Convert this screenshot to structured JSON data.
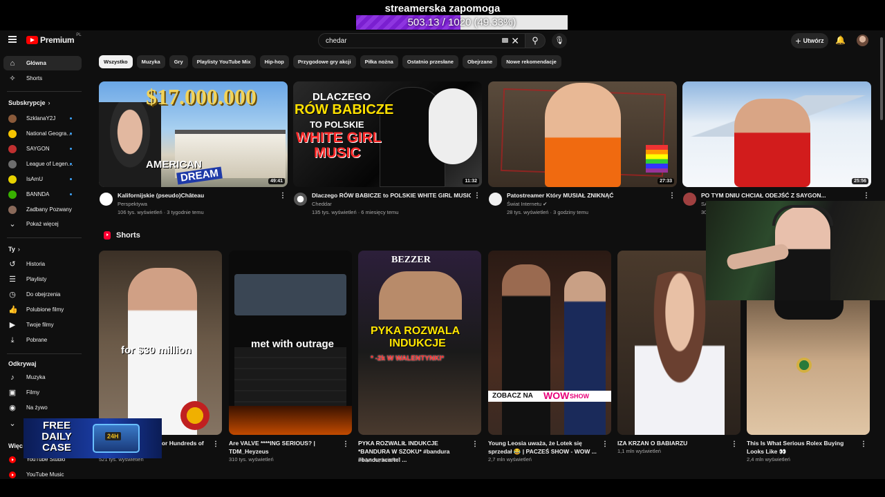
{
  "donation": {
    "title": "streamerska zapomoga",
    "progress_text": "503.13 / 1020 (49.33%)",
    "progress_fraction": 0.4933,
    "bar_color": "#7a1fd0"
  },
  "header": {
    "brand": "Premium",
    "region": "PL",
    "search_value": "chedar",
    "create_label": "Utwórz"
  },
  "sidebar": {
    "main": [
      {
        "label": "Główna",
        "icon": "home-icon",
        "glyph": "⌂"
      },
      {
        "label": "Shorts",
        "icon": "shorts-icon",
        "glyph": "✧"
      }
    ],
    "subs_heading": "Subskrypcje",
    "subscriptions": [
      {
        "label": "SzklanaY2J",
        "color": "#8a5a3a",
        "dot": true
      },
      {
        "label": "National Geogra…",
        "color": "#f5c400",
        "dot": true
      },
      {
        "label": "SAYGON",
        "color": "#c03030",
        "dot": true
      },
      {
        "label": "League of Legen…",
        "color": "#6d6d6d",
        "dot": true
      },
      {
        "label": "IsAmU",
        "color": "#e8d200",
        "dot": true
      },
      {
        "label": "BANNDA",
        "color": "#38b000",
        "dot": true
      },
      {
        "label": "Zadbany Pozwany",
        "color": "#8a6a5a",
        "dot": false
      }
    ],
    "show_more": "Pokaż więcej",
    "you_heading": "Ty",
    "you": [
      {
        "label": "Historia",
        "icon": "history-icon",
        "glyph": "↺"
      },
      {
        "label": "Playlisty",
        "icon": "playlists-icon",
        "glyph": "☰"
      },
      {
        "label": "Do obejrzenia",
        "icon": "watch-later-icon",
        "glyph": "◷"
      },
      {
        "label": "Polubione filmy",
        "icon": "thumbs-up-icon",
        "glyph": "👍"
      },
      {
        "label": "Twoje filmy",
        "icon": "your-videos-icon",
        "glyph": "▶"
      },
      {
        "label": "Pobrane",
        "icon": "download-icon",
        "glyph": "⤓"
      }
    ],
    "explore_heading": "Odkrywaj",
    "explore": [
      {
        "label": "Muzyka",
        "icon": "music-icon",
        "glyph": "♪"
      },
      {
        "label": "Filmy",
        "icon": "movies-icon",
        "glyph": "▣"
      },
      {
        "label": "Na żywo",
        "icon": "live-icon",
        "glyph": "◉"
      }
    ],
    "more_heading": "Więc",
    "more": [
      {
        "label": "YouTube Studio"
      },
      {
        "label": "YouTube Music"
      }
    ]
  },
  "chips": [
    "Wszystko",
    "Muzyka",
    "Gry",
    "Playlisty YouTube Mix",
    "Hip-hop",
    "Przygodowe gry akcji",
    "Piłka nożna",
    "Ostatnio przesłane",
    "Obejrzane",
    "Nowe rekomendacje"
  ],
  "videos": [
    {
      "title": "Kalifornijskie (pseudo)Château",
      "channel": "Perspektywa",
      "stats": "106 tys. wyświetleń · 3 tygodnie temu",
      "duration": "49:41",
      "thumb_text_1": "$17.000.000",
      "thumb_text_2": "AMERICAN",
      "thumb_text_3": "DREAM",
      "av_color": "#ffffff"
    },
    {
      "title": "Dlaczego RÓW BABICZE to POLSKIE WHITE GIRL MUSIC",
      "channel": "Cheddar",
      "stats": "135 tys. wyświetleń · 6 miesięcy temu",
      "duration": "11:32",
      "thumb_text_1": "DLACZEGO",
      "thumb_text_2": "RÓW BABICZE",
      "thumb_text_3": "TO POLSKIE",
      "thumb_text_4": "WHITE GIRL",
      "thumb_text_5": "MUSIC",
      "av_color": "#d0d0d0"
    },
    {
      "title": "Patostreamer Który MUSIAŁ ZNIKNĄĆ",
      "channel": "Świat Internetu",
      "stats": "28 tys. wyświetleń · 3 godziny temu",
      "duration": "27:33",
      "av_color": "#f0f0f0"
    },
    {
      "title": "PO TYM DNIU CHCIAŁ ODEJŚĆ Z SAYGON...",
      "channel": "SA",
      "stats": "30",
      "duration": "25:56",
      "av_color": "#a04040"
    }
  ],
  "shorts_heading": "Shorts",
  "shorts": [
    {
      "title": "for Hundreds of",
      "stats": "521 tys. wyświetleń",
      "overlay": "for $30 million"
    },
    {
      "title": "Are VALVE ****ING SERIOUS? | TDM_Heyzeus",
      "stats": "310 tys. wyświetleń",
      "overlay": "met with outrage"
    },
    {
      "title": "PYKA ROZWALIŁ INDUKCJE *BANDURA W SZOKU* #bandura #banduracartel ...",
      "stats": "34 tys. wyświetleń",
      "overlay_1": "PYKA ROZWALA",
      "overlay_2": "INDUKCJE",
      "overlay_3": "* -2k W WALENTYNKI*",
      "brand": "BEZZER"
    },
    {
      "title": "Young Leosia uważa, że Lotek się sprzedał 😂 | PACZEŚ SHOW - WOW ...",
      "stats": "2,7 mln wyświetleń",
      "overlay_1": "ZOBACZ NA",
      "overlay_2": "WOW",
      "overlay_3": "SHOW"
    },
    {
      "title": "IZA KRZAN O BABIARZU",
      "stats": "1,1 mln wyświetleń"
    },
    {
      "title": "This Is What Serious Rolex Buying Looks Like 👀",
      "stats": "2,4 mln wyświetleń"
    }
  ],
  "promo": {
    "line1": "FREE",
    "line2": "DAILY",
    "line3": "CASE",
    "badge": "24H"
  }
}
